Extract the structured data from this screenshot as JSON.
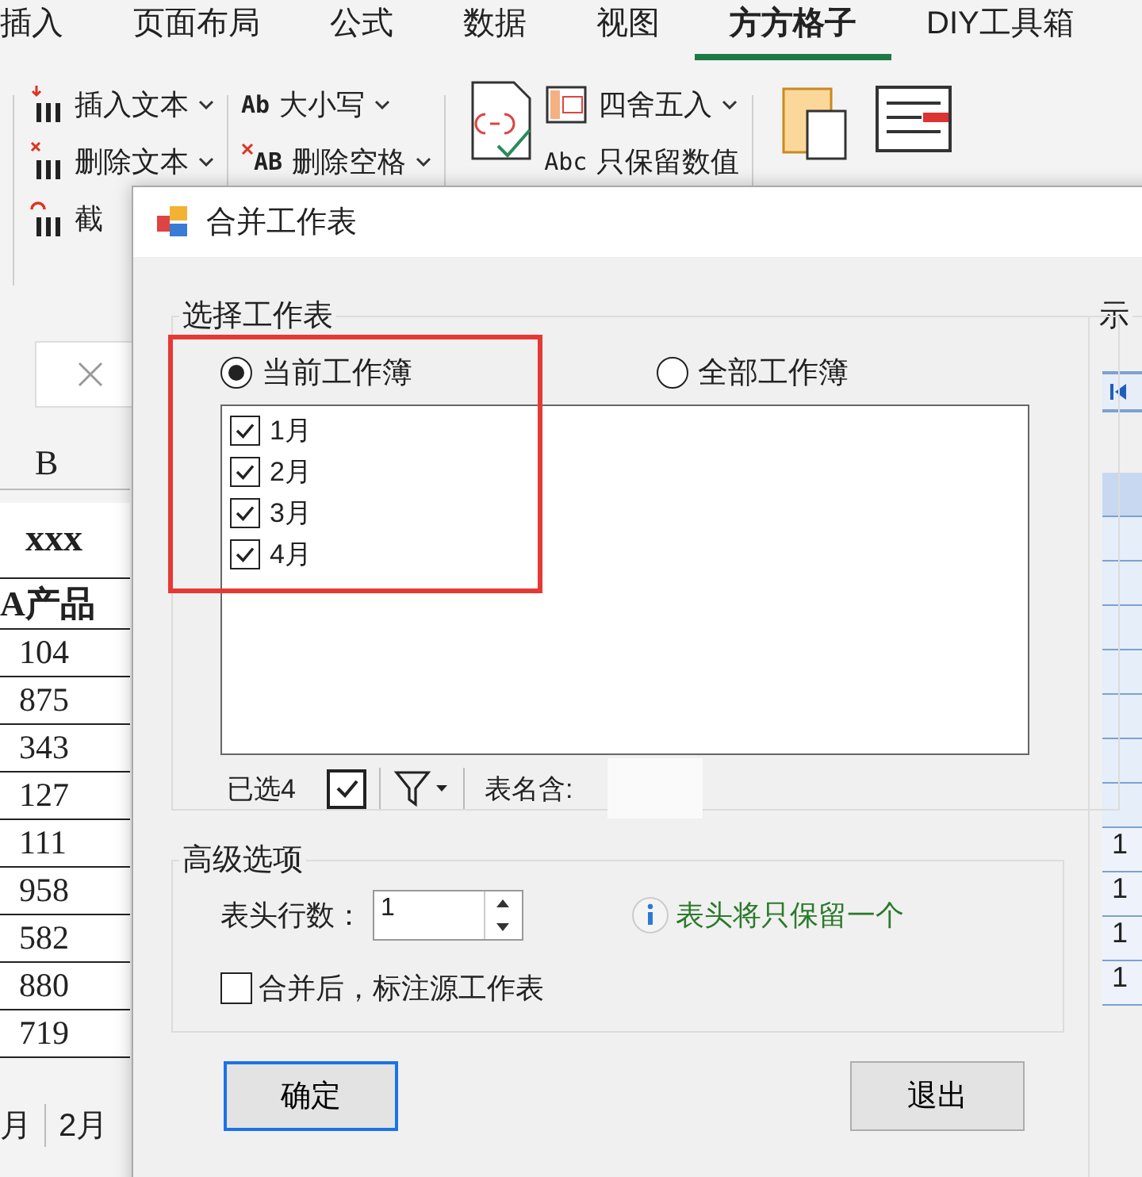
{
  "ribbon_tabs": [
    {
      "label": "插入",
      "selected": false
    },
    {
      "label": "页面布局",
      "selected": false
    },
    {
      "label": "公式",
      "selected": false
    },
    {
      "label": "数据",
      "selected": false
    },
    {
      "label": "视图",
      "selected": false
    },
    {
      "label": "方方格子",
      "selected": true
    },
    {
      "label": "DIY工具箱",
      "selected": false
    }
  ],
  "text_group": [
    {
      "label": "插入文本",
      "kind": "insert",
      "dropdown": true
    },
    {
      "label": "删除文本",
      "kind": "delete",
      "dropdown": true
    },
    {
      "label": "截",
      "kind": "cut",
      "dropdown": false
    }
  ],
  "case_group": [
    {
      "glyph": "Ab",
      "label": "大小写",
      "dropdown": true
    },
    {
      "glyph": "AB",
      "label": "删除空格",
      "dropdown": true
    }
  ],
  "number_group": {
    "items": [
      {
        "kind": "round",
        "label": "四舍五入",
        "dropdown": true
      },
      {
        "kind": "values",
        "glyph": "Abc",
        "label": "只保留数值",
        "dropdown": false
      }
    ]
  },
  "clipboard_group": [
    {
      "kind": "paste"
    },
    {
      "kind": "insert"
    }
  ],
  "sheet": {
    "column": "B",
    "title": "xxx",
    "header": "A产品",
    "values": [
      "104",
      "875",
      "343",
      "127",
      "111",
      "958",
      "582",
      "880",
      "719"
    ]
  },
  "sheet_tabs": [
    "月",
    "2月"
  ],
  "dialog": {
    "title": "合并工作表",
    "select_group": {
      "legend": "选择工作表",
      "sources": [
        {
          "label": "当前工作簿",
          "selected": true
        },
        {
          "label": "全部工作簿",
          "selected": false
        }
      ],
      "sheets": [
        {
          "label": "1月",
          "checked": true
        },
        {
          "label": "2月",
          "checked": true
        },
        {
          "label": "3月",
          "checked": true
        },
        {
          "label": "4月",
          "checked": true
        }
      ],
      "selected_count": "已选4",
      "select_all_checked": true,
      "name_filter_label": "表名含:"
    },
    "preview": {
      "legend": "示",
      "values": [
        "1",
        "1",
        "1",
        "1"
      ]
    },
    "advanced": {
      "legend": "高级选项",
      "header_rows_label": "表头行数：",
      "header_rows": "1",
      "hint": "表头将只保留一个",
      "mark_source": {
        "label": "合并后，标注源工作表",
        "checked": false
      }
    },
    "buttons": [
      {
        "label": "确定",
        "default": true
      },
      {
        "label": "退出",
        "default": false
      }
    ]
  }
}
